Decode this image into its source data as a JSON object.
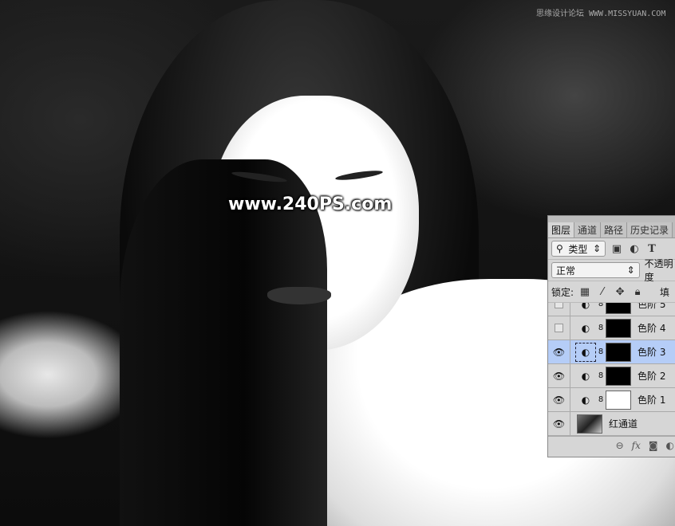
{
  "watermark": "www.240PS.com",
  "site_watermark": "思缘设计论坛 WWW.MISSYUAN.COM",
  "panel": {
    "tabs": [
      "图层",
      "通道",
      "路径",
      "历史记录"
    ],
    "filter_kind": "类型",
    "blend_mode": "正常",
    "opacity_label": "不透明度",
    "lock_label": "锁定:",
    "fill_label": "填",
    "layers": [
      {
        "name": "色阶 5",
        "visible": false
      },
      {
        "name": "色阶 4",
        "visible": false
      },
      {
        "name": "色阶 3",
        "visible": true,
        "selected": true
      },
      {
        "name": "色阶 2",
        "visible": true
      },
      {
        "name": "色阶 1",
        "visible": true
      },
      {
        "name": "红通道",
        "visible": true
      }
    ],
    "footer_fx": "fx"
  },
  "colors": {
    "selected_row": "#b5cdf7",
    "panel_bg": "#d6d6d6"
  }
}
